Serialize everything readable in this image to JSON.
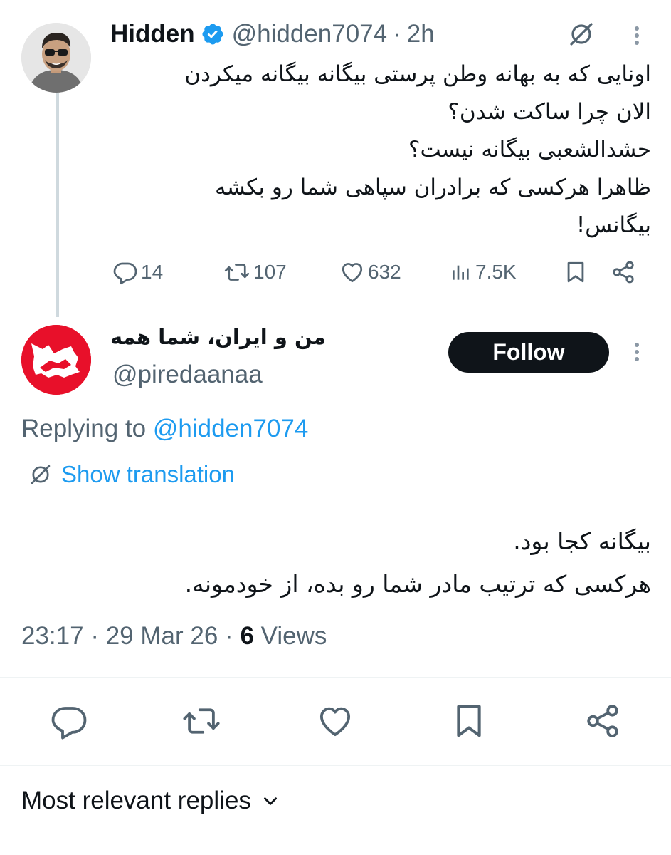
{
  "original_tweet": {
    "author_name": "Hidden",
    "handle": "@hidden7074",
    "separator": "·",
    "time": "2h",
    "text_lines": [
      "اونایی که به بهانه وطن پرستی بیگانه بیگانه میکردن",
      "الان چرا ساکت شدن؟",
      "حشدالشعبی بیگانه نیست؟",
      "ظاهرا هرکسی که برادران سپاهی شما رو بکشه",
      "بیگانس!"
    ],
    "stats": {
      "replies": "14",
      "reposts": "107",
      "likes": "632",
      "views": "7.5K"
    }
  },
  "reply_tweet": {
    "author_name": "من و ایران، شما همه",
    "handle": "@piredaanaa",
    "follow_label": "Follow",
    "replying_prefix": "Replying to",
    "replying_to": "@hidden7074",
    "translation_label": "Show translation",
    "text_lines": [
      "بیگانه کجا بود.",
      "هرکسی که ترتیب مادر شما رو بده، از خودمونه."
    ],
    "time": "23:17",
    "date": "29 Mar 26",
    "views_count": "6",
    "views_label": "Views"
  },
  "sort": {
    "label": "Most relevant replies"
  },
  "colors": {
    "accent": "#1d9bf0",
    "text_primary": "#0f1419",
    "text_secondary": "#536471",
    "follow_bg": "#0f1419",
    "avatar_red": "#e8102a"
  }
}
